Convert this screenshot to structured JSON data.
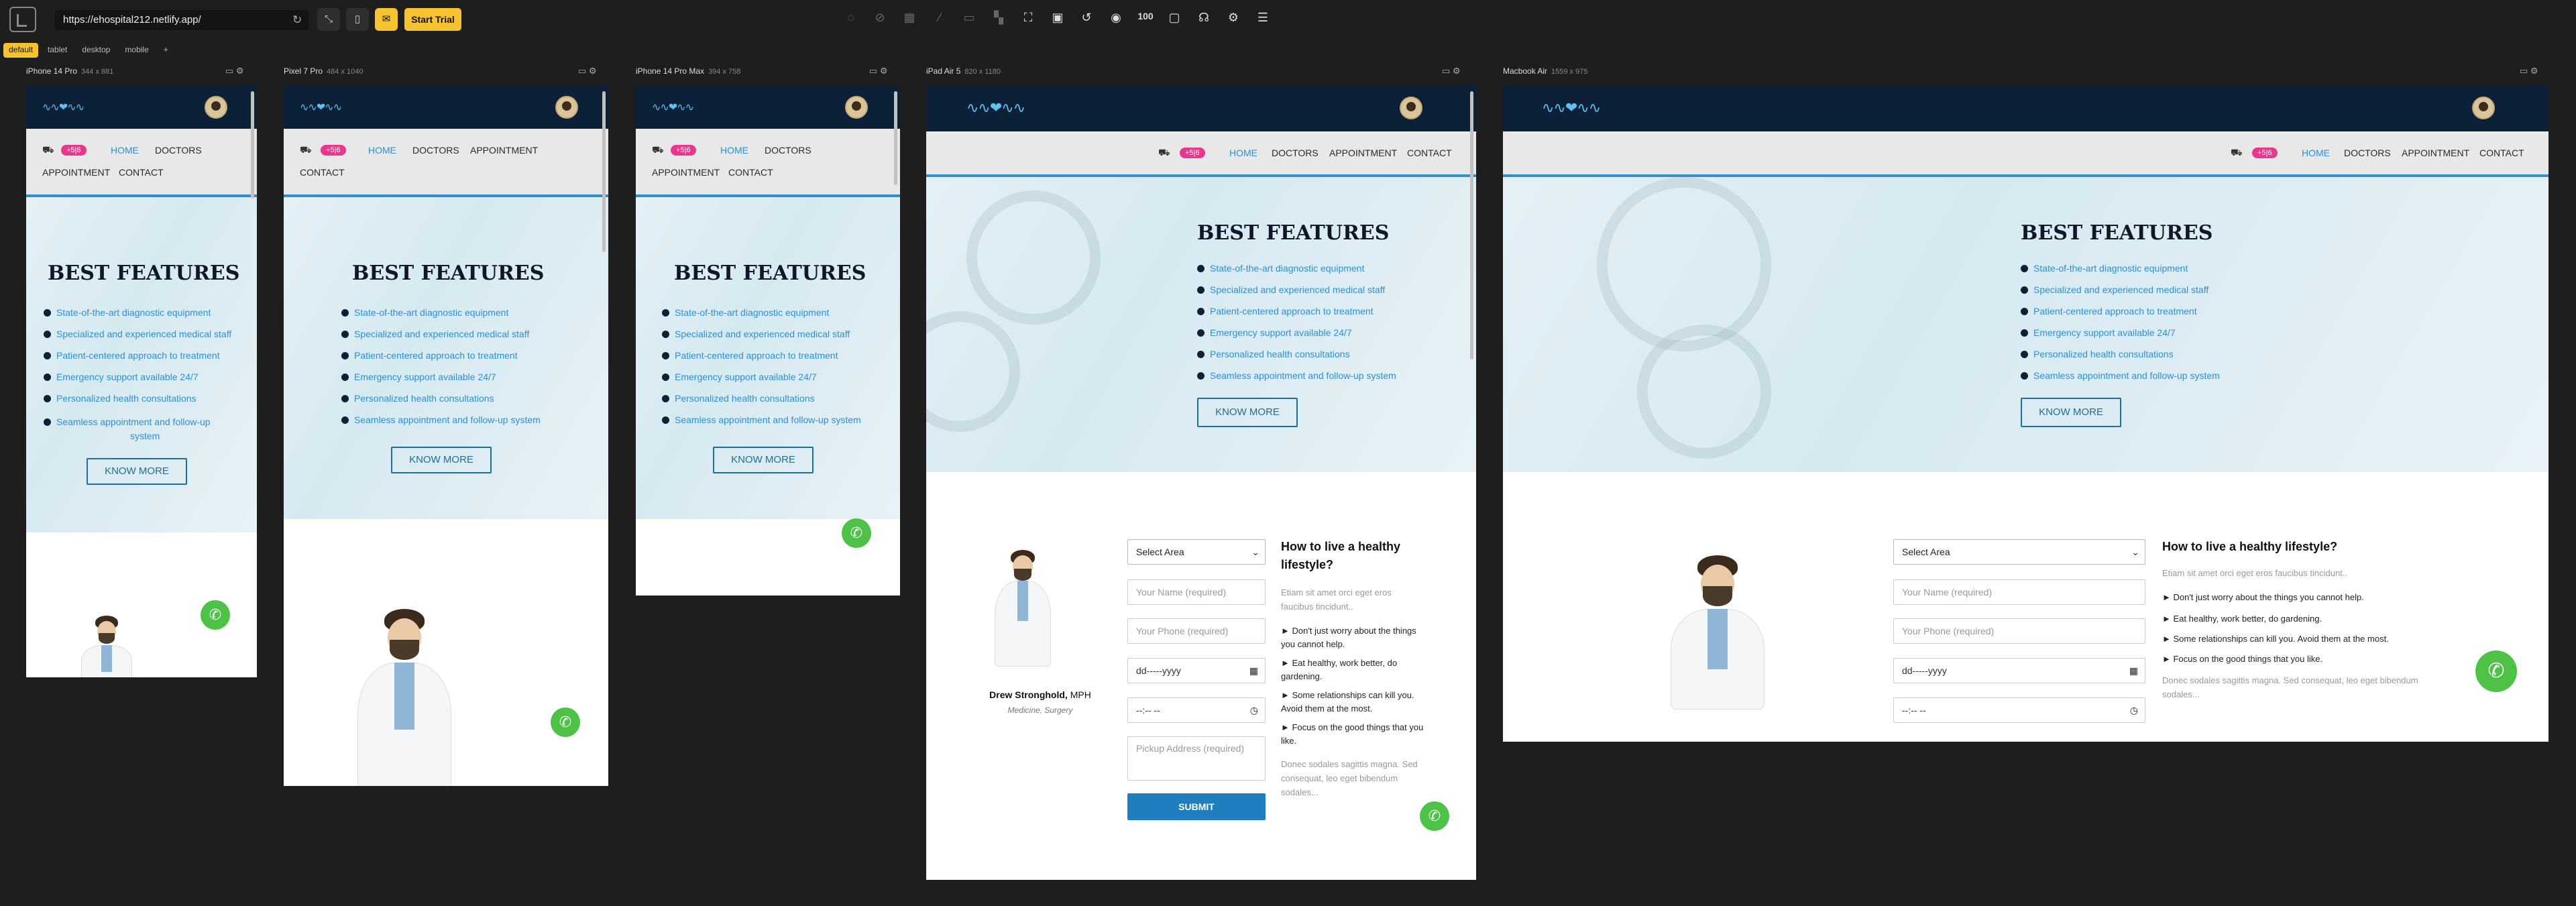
{
  "toolbar": {
    "url": "https://ehospital212.netlify.app/",
    "start_trial": "Start Trial",
    "zoom": "100"
  },
  "tabs": [
    "default",
    "tablet",
    "desktop",
    "mobile",
    "+"
  ],
  "devices": [
    {
      "name": "iPhone 14 Pro",
      "size": "344 x 881"
    },
    {
      "name": "Pixel 7 Pro",
      "size": "484 x 1040"
    },
    {
      "name": "iPhone 14 Pro Max",
      "size": "394 x 758"
    },
    {
      "name": "iPad Air 5",
      "size": "820 x 1180"
    },
    {
      "name": "Macbook Air",
      "size": "1559 x 975"
    }
  ],
  "site": {
    "phone_pill": "+5|6",
    "nav": [
      "HOME",
      "DOCTORS",
      "APPOINTMENT",
      "CONTACT"
    ],
    "hero_title": "BEST FEATURES",
    "features": [
      "State-of-the-art diagnostic equipment",
      "Specialized and experienced medical staff",
      "Patient-centered approach to treatment",
      "Emergency support available 24/7",
      "Personalized health consultations",
      "Seamless appointment and follow-up system"
    ],
    "feature6_line1": "Seamless appointment and follow-up",
    "feature6_line2": "system",
    "know_more": "KNOW MORE",
    "doctor_name": "Drew Stronghold,",
    "doctor_degree": "MPH",
    "doctor_role": "Medicine, Surgery",
    "form": {
      "area": "Select Area",
      "name_ph": "Your Name (required)",
      "phone_ph": "Your Phone (required)",
      "date": "dd-----yyyy",
      "time": "--:-- --",
      "address_ph": "Pickup Address (required)",
      "submit": "SUBMIT"
    },
    "tip": {
      "title": "How to live a healthy lifestyle?",
      "intro_tablet": "Etiam sit amet orci eget eros faucibus tincidunt..",
      "intro_desktop": "Etiam sit amet orci eget eros faucibus tincidunt..",
      "items": [
        "► Don't just worry about the things you cannot help.",
        "► Eat healthy, work better, do gardening.",
        "► Some relationships can kill you. Avoid them at the most.",
        "► Focus on the good things that you like."
      ],
      "outro": "Donec sodales sagittis magna. Sed consequat, leo eget bibendum sodales..."
    }
  },
  "colors": {
    "accent": "#2d8fd1",
    "pill": "#e8378d",
    "header": "#0c2038",
    "trial": "#f6c22f",
    "whatsapp": "#4dc247"
  }
}
